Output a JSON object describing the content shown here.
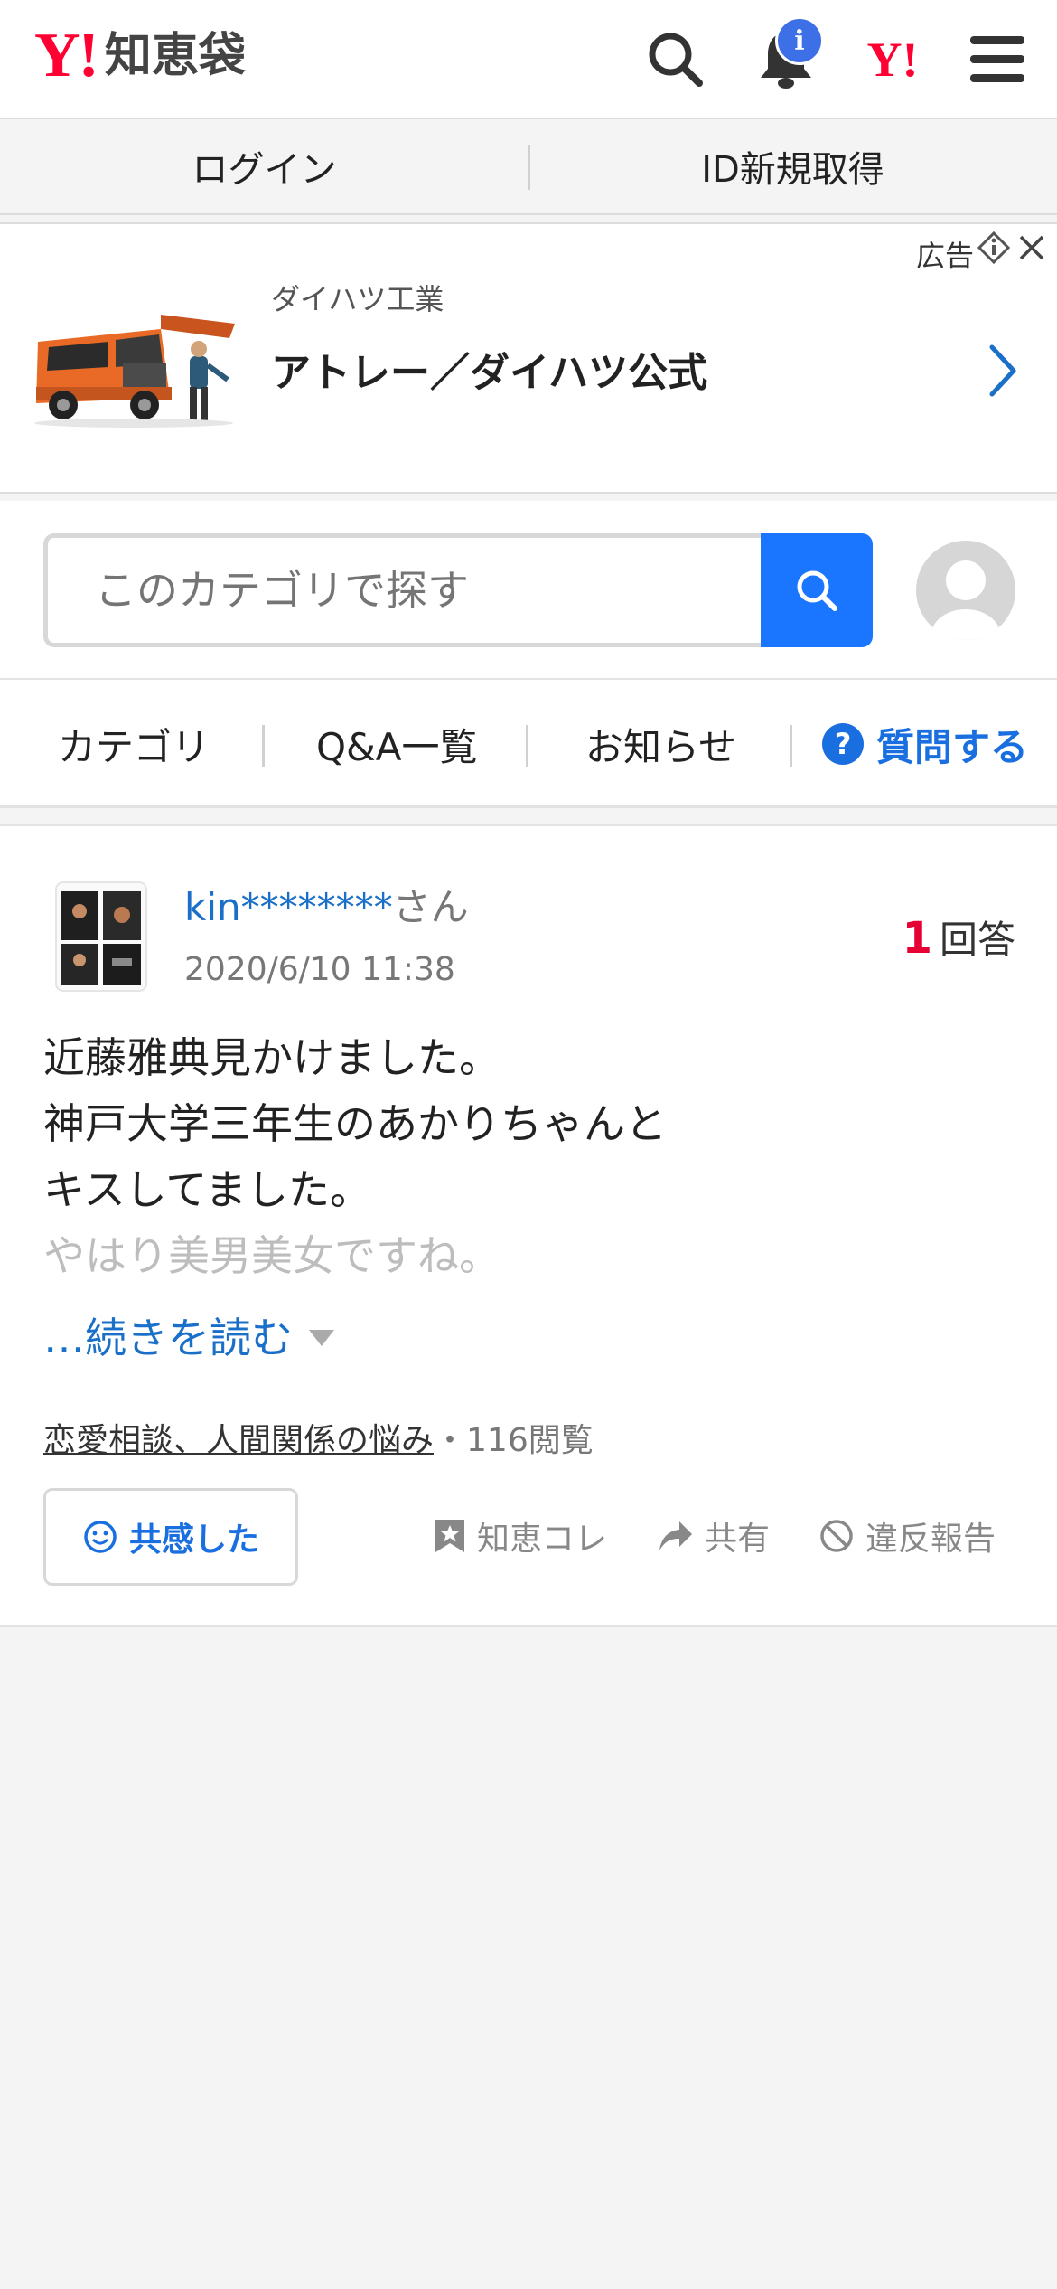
{
  "header": {
    "logo_mark": "Y!",
    "logo_text": "知恵袋",
    "notification_badge": "i",
    "yahoo_japan_mark": "Y!"
  },
  "auth": {
    "login_label": "ログイン",
    "register_label": "ID新規取得"
  },
  "ad": {
    "label": "広告",
    "company": "ダイハツ工業",
    "title": "アトレー／ダイハツ公式"
  },
  "search": {
    "placeholder": "このカテゴリで探す"
  },
  "nav": {
    "items": [
      "カテゴリ",
      "Q&A一覧",
      "お知らせ"
    ],
    "ask_icon": "?",
    "ask_label": "質問する"
  },
  "question": {
    "user_name": "kin********",
    "user_suffix": "さん",
    "date": "2020/6/10 11:38",
    "answer_count": "1",
    "answer_label": "回答",
    "body_lines": [
      "近藤雅典見かけました。",
      "神戸大学三年生のあかりちゃんと",
      "キスしてました。",
      "やはり美男美女ですね。"
    ],
    "read_more": "…続きを読む",
    "category": "恋愛相談、人間関係の悩み",
    "separator": "・",
    "views": "116閲覧",
    "empathy_label": "共感した",
    "actions": {
      "collect": "知恵コレ",
      "share": "共有",
      "report": "違反報告"
    }
  },
  "colors": {
    "brand_red": "#ff0033",
    "link_blue": "#1a6fc8",
    "action_blue": "#1a75ff",
    "answer_red": "#e60033"
  }
}
